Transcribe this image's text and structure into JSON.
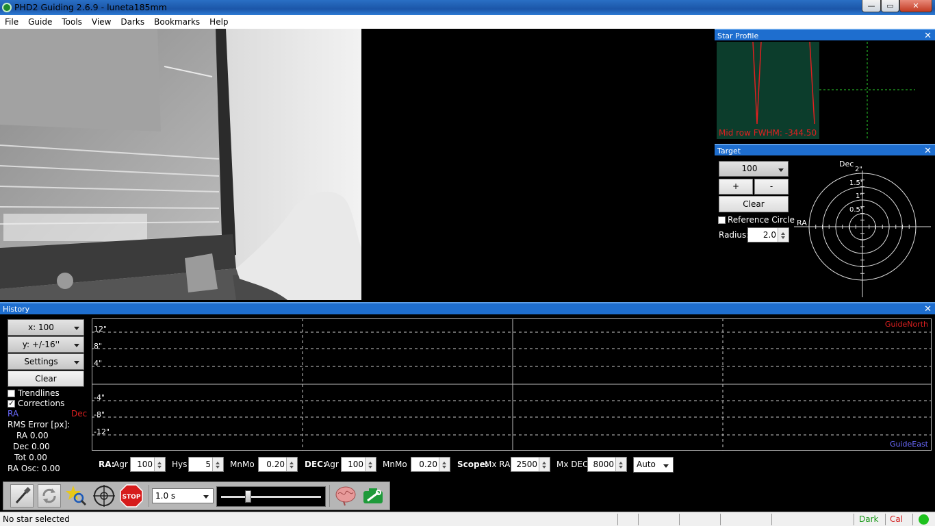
{
  "window": {
    "title": "PHD2 Guiding 2.6.9 - luneta185mm",
    "minimize": "—",
    "maximize": "▭",
    "close": "✕"
  },
  "menu": [
    "File",
    "Guide",
    "Tools",
    "View",
    "Darks",
    "Bookmarks",
    "Help"
  ],
  "star_profile": {
    "title": "Star Profile",
    "close": "✕",
    "fwhm_text": "Mid row FWHM: -344.50"
  },
  "target": {
    "title": "Target",
    "close": "✕",
    "zoom_value": "100",
    "plus": "+",
    "minus": "-",
    "clear": "Clear",
    "reference_circle_label": "Reference Circle",
    "radius_label": "Radius:",
    "radius_value": "2.0",
    "dec_label": "Dec",
    "ra_label": "RA",
    "ring_labels": [
      "2\"",
      "1.5\"",
      "1\"",
      "0.5\""
    ]
  },
  "history": {
    "title": "History",
    "close": "✕",
    "x_scale": "x: 100",
    "y_scale": "y: +/-16''",
    "settings": "Settings",
    "clear": "Clear",
    "trendlines_label": "Trendlines",
    "corrections_label": "Corrections",
    "corrections_checked": true,
    "trendlines_checked": false,
    "ra_legend": "RA",
    "dec_legend": "Dec",
    "rms_title": "RMS Error [px]:",
    "ra_rms": "RA 0.00",
    "dec_rms": "Dec 0.00",
    "tot_rms": "Tot 0.00",
    "ra_osc": "RA Osc: 0.00",
    "y_ticks": [
      "12\"",
      "8\"",
      "4\"",
      "-4\"",
      "-8\"",
      "-12\""
    ],
    "guide_north": "GuideNorth",
    "guide_east": "GuideEast"
  },
  "controls": {
    "ra_label": "RA:",
    "agr_label": "Agr",
    "ra_agr": "100",
    "hys_label": "Hys",
    "ra_hys": "5",
    "mnmo_label": "MnMo",
    "ra_mnmo": "0.20",
    "dec_label": "DEC:",
    "dec_agr_label": "Agr",
    "dec_agr": "100",
    "dec_mnmo_label": "MnMo",
    "dec_mnmo": "0.20",
    "scope_label": "Scope:",
    "mxra_label": "Mx RA",
    "mx_ra": "2500",
    "mxdec_label": "Mx DEC",
    "mx_dec": "8000",
    "dec_mode": "Auto"
  },
  "toolbar": {
    "exposure": "1.0 s",
    "stop_label": "STOP",
    "gamma_fraction": 0.27
  },
  "status": {
    "message": "No star selected",
    "dark": "Dark",
    "cal": "Cal",
    "dark_color": "#1a9a1a",
    "cal_color": "#d42020",
    "led_color": "#1fc21f"
  }
}
